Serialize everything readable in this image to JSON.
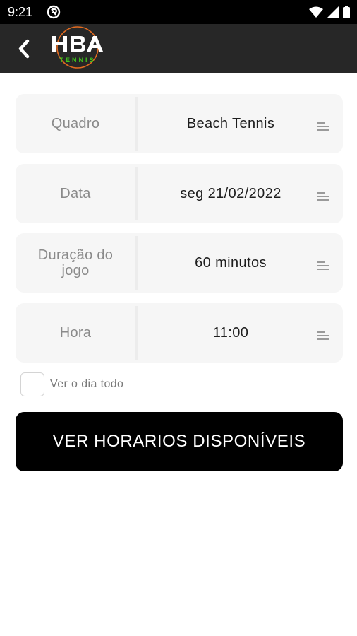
{
  "status_bar": {
    "time": "9:21"
  },
  "app_bar": {
    "logo_text": "HBA",
    "logo_subtext": "TENNIS",
    "accent_color": "#e36b1f",
    "logo_green": "#3fc31c"
  },
  "form": {
    "fields": [
      {
        "label": "Quadro",
        "value": "Beach Tennis"
      },
      {
        "label": "Data",
        "value": "seg 21/02/2022"
      },
      {
        "label": "Duração do jogo",
        "value": "60 minutos"
      },
      {
        "label": "Hora",
        "value": "11:00"
      }
    ],
    "checkbox_label": "Ver o dia todo",
    "submit_label": "VER HORARIOS DISPONÍVEIS"
  }
}
